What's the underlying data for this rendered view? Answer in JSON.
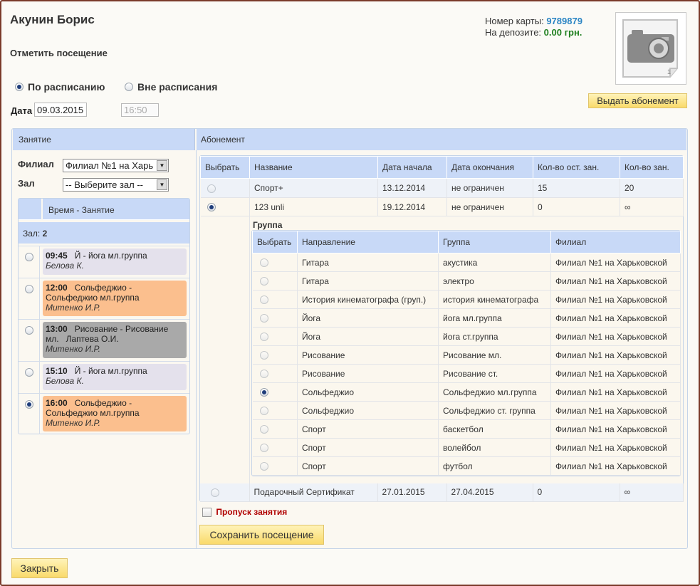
{
  "client": {
    "name": "Акунин Борис"
  },
  "mark_title": "Отметить посещение",
  "mode": {
    "scheduled_label": "По расписанию",
    "unscheduled_label": "Вне расписания"
  },
  "date": {
    "label": "Дата",
    "value": "09.03.2015",
    "time": "16:50"
  },
  "card": {
    "number_label": "Номер карты:",
    "number": "9789879",
    "deposit_label": "На депозите:",
    "deposit": "0.00 грн."
  },
  "issue_button": "Выдать абонемент",
  "lesson_section": {
    "header": "Занятие",
    "branch_label": "Филиал",
    "branch_value": "Филиал №1 на Харь",
    "hall_label": "Зал",
    "hall_value": "-- Выберите зал --",
    "schedule_header": "Время - Занятие",
    "hall_row_label": "Зал:",
    "hall_row_value": "2",
    "lessons": [
      {
        "time": "09:45",
        "title": "Й - йога мл.группа",
        "extra": "",
        "teacher": "Белова К.",
        "selected": false
      },
      {
        "time": "12:00",
        "title": "Сольфеджио - Сольфеджио мл.группа",
        "extra": "",
        "teacher": "Митенко И.Р.",
        "selected": false
      },
      {
        "time": "13:00",
        "title": "Рисование - Рисование мл.",
        "extra": "Лаптева О.И.",
        "teacher": "Митенко И.Р.",
        "selected": false
      },
      {
        "time": "15:10",
        "title": "Й - йога мл.группа",
        "extra": "",
        "teacher": "Белова К.",
        "selected": false
      },
      {
        "time": "16:00",
        "title": "Сольфеджио - Сольфеджио мл.группа",
        "extra": "",
        "teacher": "Митенко И.Р.",
        "selected": true
      }
    ]
  },
  "subscription_section": {
    "header": "Абонемент",
    "columns": [
      "Выбрать",
      "Название",
      "Дата начала",
      "Дата окончания",
      "Кол-во ост. зан.",
      "Кол-во зан."
    ],
    "rows": [
      {
        "name": "Спорт+",
        "start": "13.12.2014",
        "end": "не ограничен",
        "left": "15",
        "total": "20",
        "selected": false
      },
      {
        "name": "123 unli",
        "start": "19.12.2014",
        "end": "не ограничен",
        "left": "0",
        "total": "∞",
        "selected": true
      }
    ],
    "last_row": {
      "name": "Подарочный Сертификат",
      "start": "27.01.2015",
      "end": "27.04.2015",
      "left": "0",
      "total": "∞",
      "selected": false
    },
    "group": {
      "title": "Группа",
      "columns": [
        "Выбрать",
        "Направление",
        "Группа",
        "Филиал"
      ],
      "rows": [
        {
          "direction": "Гитара",
          "group": "акустика",
          "branch": "Филиал №1 на Харьковской",
          "selected": false
        },
        {
          "direction": "Гитара",
          "group": "электро",
          "branch": "Филиал №1 на Харьковской",
          "selected": false
        },
        {
          "direction": "История кинематографа (груп.)",
          "group": "история кинематографа",
          "branch": "Филиал №1 на Харьковской",
          "selected": false
        },
        {
          "direction": "Йога",
          "group": "йога мл.группа",
          "branch": "Филиал №1 на Харьковской",
          "selected": false
        },
        {
          "direction": "Йога",
          "group": "йога ст.группа",
          "branch": "Филиал №1 на Харьковской",
          "selected": false
        },
        {
          "direction": "Рисование",
          "group": "Рисование мл.",
          "branch": "Филиал №1 на Харьковской",
          "selected": false
        },
        {
          "direction": "Рисование",
          "group": "Рисование ст.",
          "branch": "Филиал №1 на Харьковской",
          "selected": false
        },
        {
          "direction": "Сольфеджио",
          "group": "Сольфеджио мл.группа",
          "branch": "Филиал №1 на Харьковской",
          "selected": true
        },
        {
          "direction": "Сольфеджио",
          "group": "Сольфеджио ст. группа",
          "branch": "Филиал №1 на Харьковской",
          "selected": false
        },
        {
          "direction": "Спорт",
          "group": "баскетбол",
          "branch": "Филиал №1 на Харьковской",
          "selected": false
        },
        {
          "direction": "Спорт",
          "group": "волейбол",
          "branch": "Филиал №1 на Харьковской",
          "selected": false
        },
        {
          "direction": "Спорт",
          "group": "футбол",
          "branch": "Филиал №1 на Харьковской",
          "selected": false
        }
      ]
    }
  },
  "skip_label": "Пропуск занятия",
  "save_button": "Сохранить посещение",
  "close_button": "Закрыть",
  "icons": {
    "photo": "camera-icon"
  },
  "colors": {
    "header_bg": "#c8d9f7",
    "yellow_button": "#f9da6b",
    "card_number": "#2b85c4",
    "deposit": "#1f7f1f",
    "skip": "#b00000"
  }
}
